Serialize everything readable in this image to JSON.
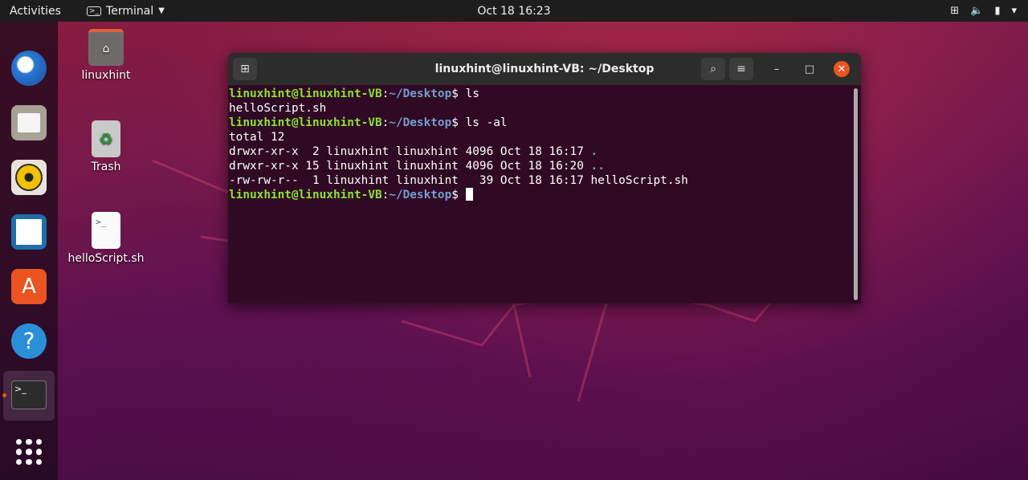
{
  "topbar": {
    "activities": "Activities",
    "app": "Terminal",
    "clock": "Oct 18  16:23",
    "tray": [
      "network-icon",
      "volume-icon",
      "battery-icon",
      "power-menu-icon"
    ]
  },
  "desktop": {
    "icons": [
      {
        "label": "linuxhint"
      },
      {
        "label": "Trash"
      },
      {
        "label": "helloScript.sh",
        "glyph": ">_"
      }
    ]
  },
  "terminal": {
    "title": "linuxhint@linuxhint-VB: ~/Desktop",
    "prompt_user": "linuxhint@linuxhint-VB",
    "prompt_path": "~/Desktop",
    "lines": [
      {
        "type": "prompt",
        "cmd": "ls"
      },
      {
        "type": "out",
        "text": "helloScript.sh"
      },
      {
        "type": "prompt",
        "cmd": "ls -al"
      },
      {
        "type": "out",
        "text": "total 12"
      },
      {
        "type": "out",
        "text": "drwxr-xr-x  2 linuxhint linuxhint 4096 Oct 18 16:17 ",
        "dir": "."
      },
      {
        "type": "out",
        "text": "drwxr-xr-x 15 linuxhint linuxhint 4096 Oct 18 16:20 ",
        "dir": ".."
      },
      {
        "type": "out",
        "text": "-rw-rw-r--  1 linuxhint linuxhint   39 Oct 18 16:17 helloScript.sh"
      },
      {
        "type": "prompt",
        "cmd": "",
        "cursor": true
      }
    ]
  },
  "colors": {
    "terminal_bg": "#300a24",
    "prompt_user": "#8ae234",
    "prompt_path": "#729fcf"
  }
}
